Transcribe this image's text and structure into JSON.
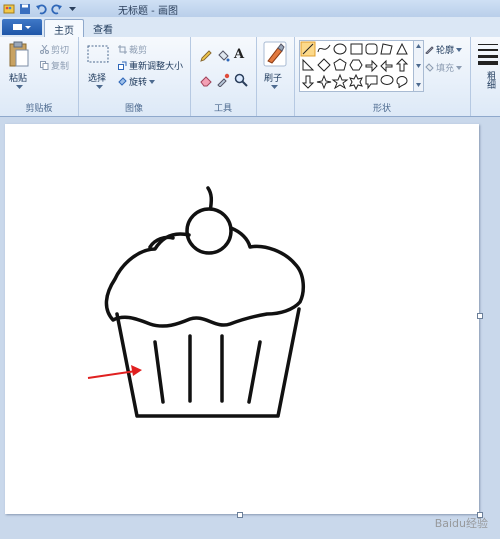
{
  "window": {
    "title": "无标题 - 画图"
  },
  "tabs": [
    {
      "label": "主页"
    },
    {
      "label": "查看"
    }
  ],
  "groups": {
    "clipboard": {
      "label": "剪贴板",
      "paste": "粘贴",
      "cut": "剪切",
      "copy": "复制"
    },
    "image": {
      "label": "图像",
      "select": "选择",
      "crop": "裁剪",
      "resize": "重新调整大小",
      "rotate": "旋转"
    },
    "tools": {
      "label": "工具"
    },
    "brushes": {
      "label": "刷子"
    },
    "shapes": {
      "label": "形状",
      "outline": "轮廓",
      "fill": "填充"
    },
    "size": {
      "label": "粗细"
    }
  },
  "watermark": "Baidu经验",
  "colors": {
    "accent": "#1f56a8",
    "arrow": "#e02020",
    "ink": "#111111"
  }
}
